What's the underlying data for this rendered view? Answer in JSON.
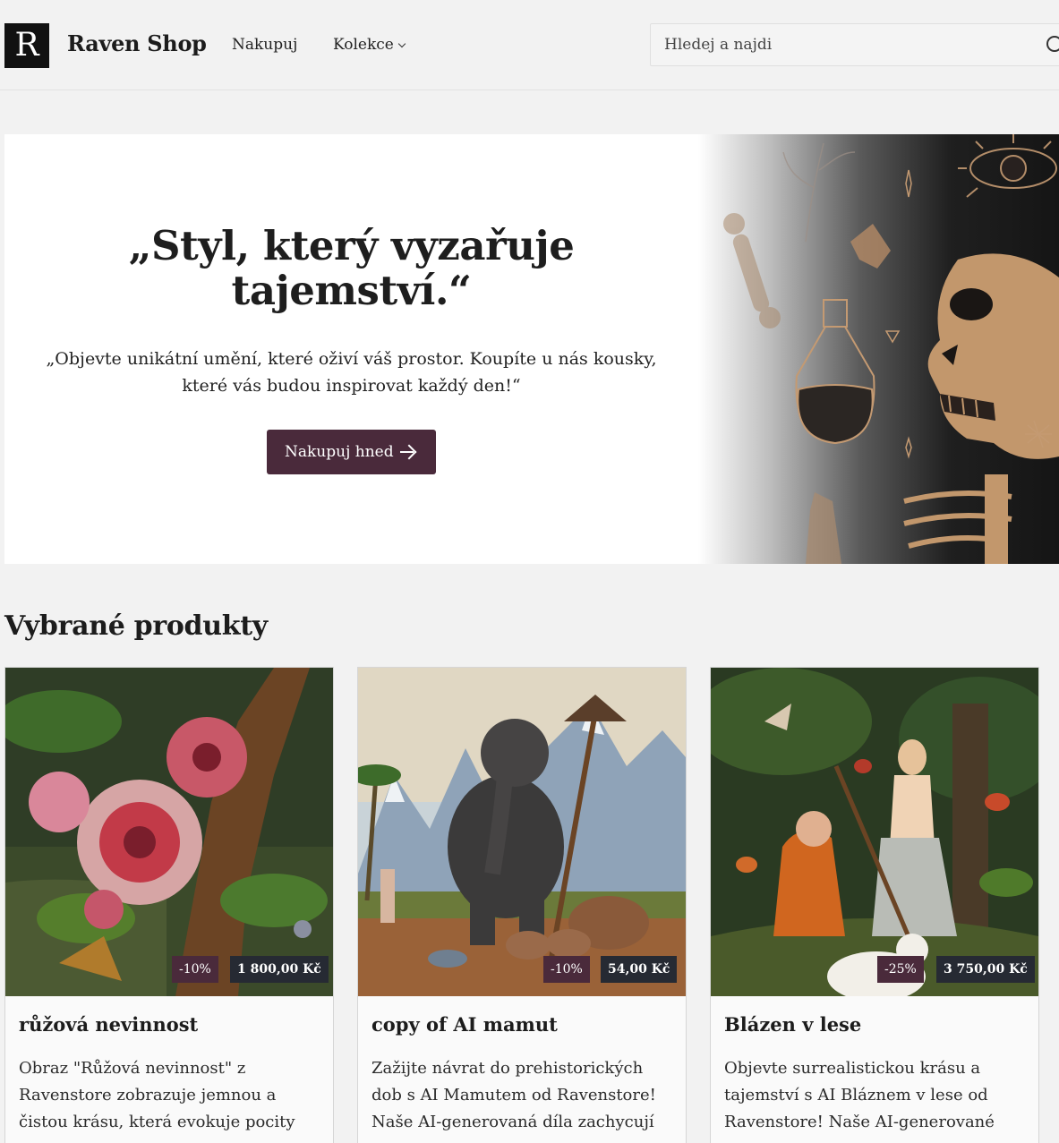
{
  "header": {
    "logo_letter": "R",
    "brand": "Raven Shop",
    "nav": {
      "shop": "Nakupuj",
      "collections": "Kolekce"
    },
    "search_placeholder": "Hledej a najdi"
  },
  "hero": {
    "title": "„Styl, který vyzařuje tajemství.“",
    "subtitle": "„Objevte unikátní umění, které oživí váš prostor. Koupíte u nás kousky, které vás budou inspirovat každý den!“",
    "button": "Nakupuj hned"
  },
  "featured": {
    "title": "Vybrané produkty",
    "products": [
      {
        "title": "růžová nevinnost",
        "discount": "-10%",
        "price": "1 800,00 Kč",
        "description": "Obraz \"Růžová nevinnost\" z Ravenstore zobrazuje jemnou a čistou krásu, která evokuje pocity"
      },
      {
        "title": "copy of AI mamut",
        "discount": "-10%",
        "price": "54,00 Kč",
        "description": "Zažijte návrat do prehistorických dob s AI Mamutem od Ravenstore! Naše AI-generovaná díla zachycují"
      },
      {
        "title": "Blázen v lese",
        "discount": "-25%",
        "price": "3 750,00 Kč",
        "description": "Objevte surrealistickou krásu a tajemství s AI Bláznem v lese od Ravenstore! Naše AI-generované"
      }
    ]
  }
}
